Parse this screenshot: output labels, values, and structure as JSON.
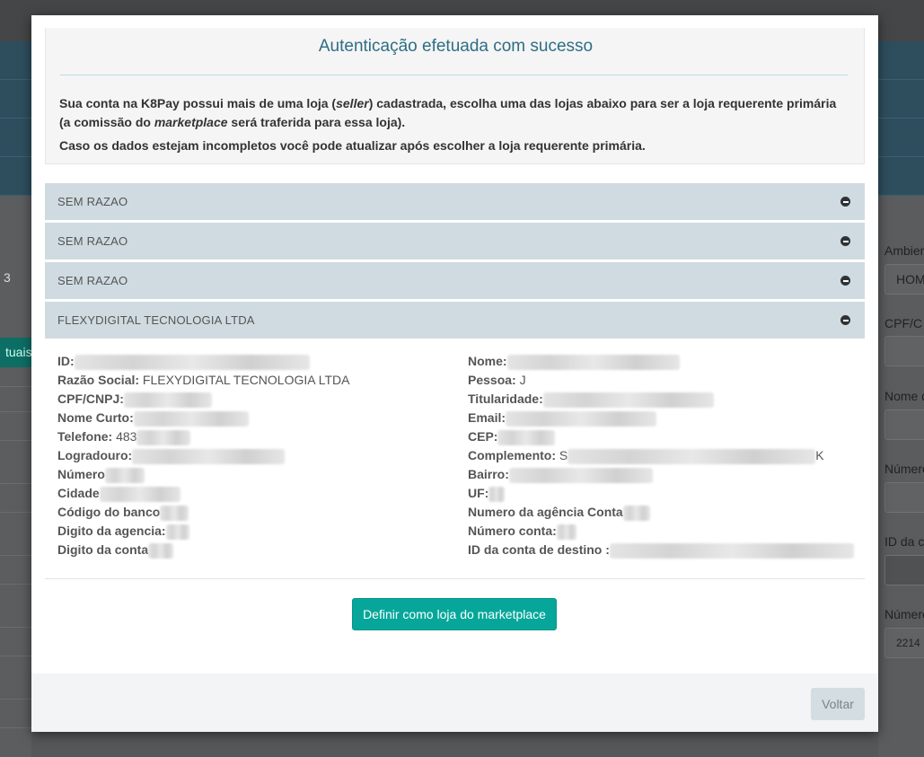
{
  "background": {
    "left_number": "3",
    "left_tab": "tuais",
    "right_fields": [
      {
        "label": "Ambien",
        "value": "HOM"
      },
      {
        "label": "CPF/C",
        "value": ""
      },
      {
        "label": "Nome d",
        "value": ""
      },
      {
        "label": "Número",
        "value": ""
      },
      {
        "label": "ID da c",
        "value": ""
      },
      {
        "label": "Número",
        "value": "2214"
      }
    ]
  },
  "modal": {
    "title": "Autenticação efetuada com sucesso",
    "intro_part1": "Sua conta na K8Pay possui mais de uma loja (",
    "intro_seller": "seller",
    "intro_part2": ") cadastrada, escolha uma das lojas abaixo para ser a loja requerente primária",
    "intro_part3": "(a comissão do ",
    "intro_marketplace": "marketplace",
    "intro_part4": " será traferida para essa loja).",
    "intro_line3": "Caso os dados estejam incompletos você pode atualizar após escolher a loja requerente primária.",
    "stores": [
      {
        "name": "SEM RAZAO"
      },
      {
        "name": "SEM RAZAO"
      },
      {
        "name": "SEM RAZAO"
      },
      {
        "name": "FLEXYDIGITAL TECNOLOGIA LTDA"
      }
    ],
    "details_left": [
      {
        "label": "ID:",
        "value": ""
      },
      {
        "label": "Razão Social:",
        "value": "FLEXYDIGITAL TECNOLOGIA LTDA"
      },
      {
        "label": "CPF/CNPJ:",
        "value": ""
      },
      {
        "label": "Nome Curto:",
        "value": ""
      },
      {
        "label": "Telefone:",
        "value": "483"
      },
      {
        "label": "Logradouro:",
        "value": ""
      },
      {
        "label": "Número",
        "value": ""
      },
      {
        "label": "Cidade",
        "value": ""
      },
      {
        "label": "Código do banco",
        "value": ""
      },
      {
        "label": "Digito da agencia:",
        "value": ""
      },
      {
        "label": "Digito da conta",
        "value": ""
      }
    ],
    "details_right": [
      {
        "label": "Nome:",
        "value": ""
      },
      {
        "label": "Pessoa:",
        "value": "J"
      },
      {
        "label": "Titularidade:",
        "value": ""
      },
      {
        "label": "Email:",
        "value": ""
      },
      {
        "label": "CEP:",
        "value": ""
      },
      {
        "label": "Complemento:",
        "value": "S",
        "suffix": "K"
      },
      {
        "label": "Bairro:",
        "value": ""
      },
      {
        "label": "UF:",
        "value": ""
      },
      {
        "label": "Numero da agência Conta",
        "value": ""
      },
      {
        "label": "Número conta:",
        "value": ""
      },
      {
        "label": "ID da conta de destino :",
        "value": ""
      }
    ],
    "define_button": "Definir como loja do marketplace",
    "back_button": "Voltar"
  }
}
